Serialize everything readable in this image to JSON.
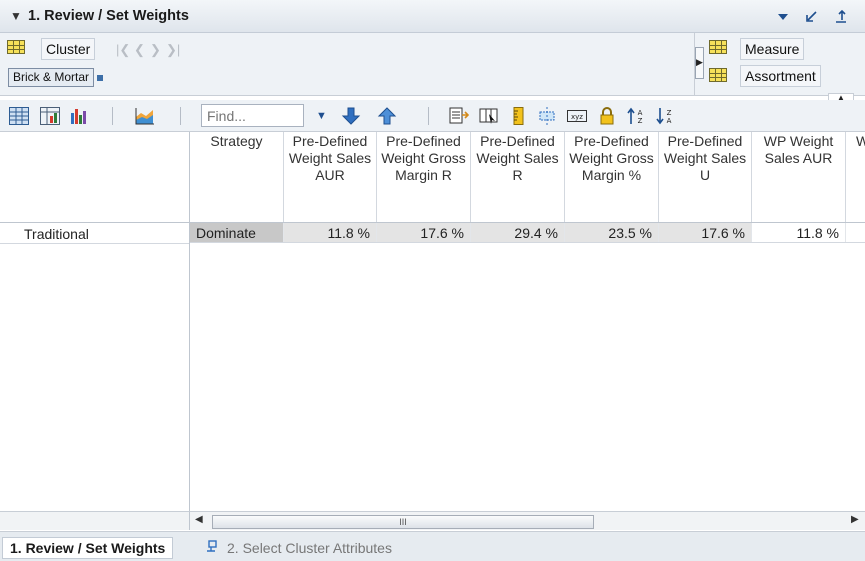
{
  "window": {
    "title": "1. Review / Set Weights"
  },
  "tiles": {
    "cluster_label": "Cluster",
    "cluster_value_chip": "Brick & Mortar",
    "measure_label": "Measure",
    "assortment_label": "Assortment"
  },
  "toolbar": {
    "find_placeholder": "Find..."
  },
  "grid": {
    "columns": [
      "Strategy",
      "Pre-Defined Weight Sales AUR",
      "Pre-Defined Weight Gross Margin R",
      "Pre-Defined Weight Sales R",
      "Pre-Defined Weight Gross Margin %",
      "Pre-Defined Weight Sales U",
      "WP Weight Sales AUR",
      "W"
    ],
    "rows": [
      {
        "label": "Traditional",
        "cells": [
          "Dominate",
          "11.8 %",
          "17.6 %",
          "29.4 %",
          "23.5 %",
          "17.6 %",
          "11.8 %",
          ""
        ]
      }
    ]
  },
  "scrollbar": {
    "thumb_grip": "III"
  },
  "tabs": [
    {
      "label": "1. Review / Set Weights",
      "active": true
    },
    {
      "label": "2. Select Cluster Attributes",
      "active": false
    }
  ],
  "colors": {
    "accent_blue": "#2f6fc0",
    "title_bg": "#e4e9ef",
    "readonly_cell": "#e4e4e4"
  }
}
